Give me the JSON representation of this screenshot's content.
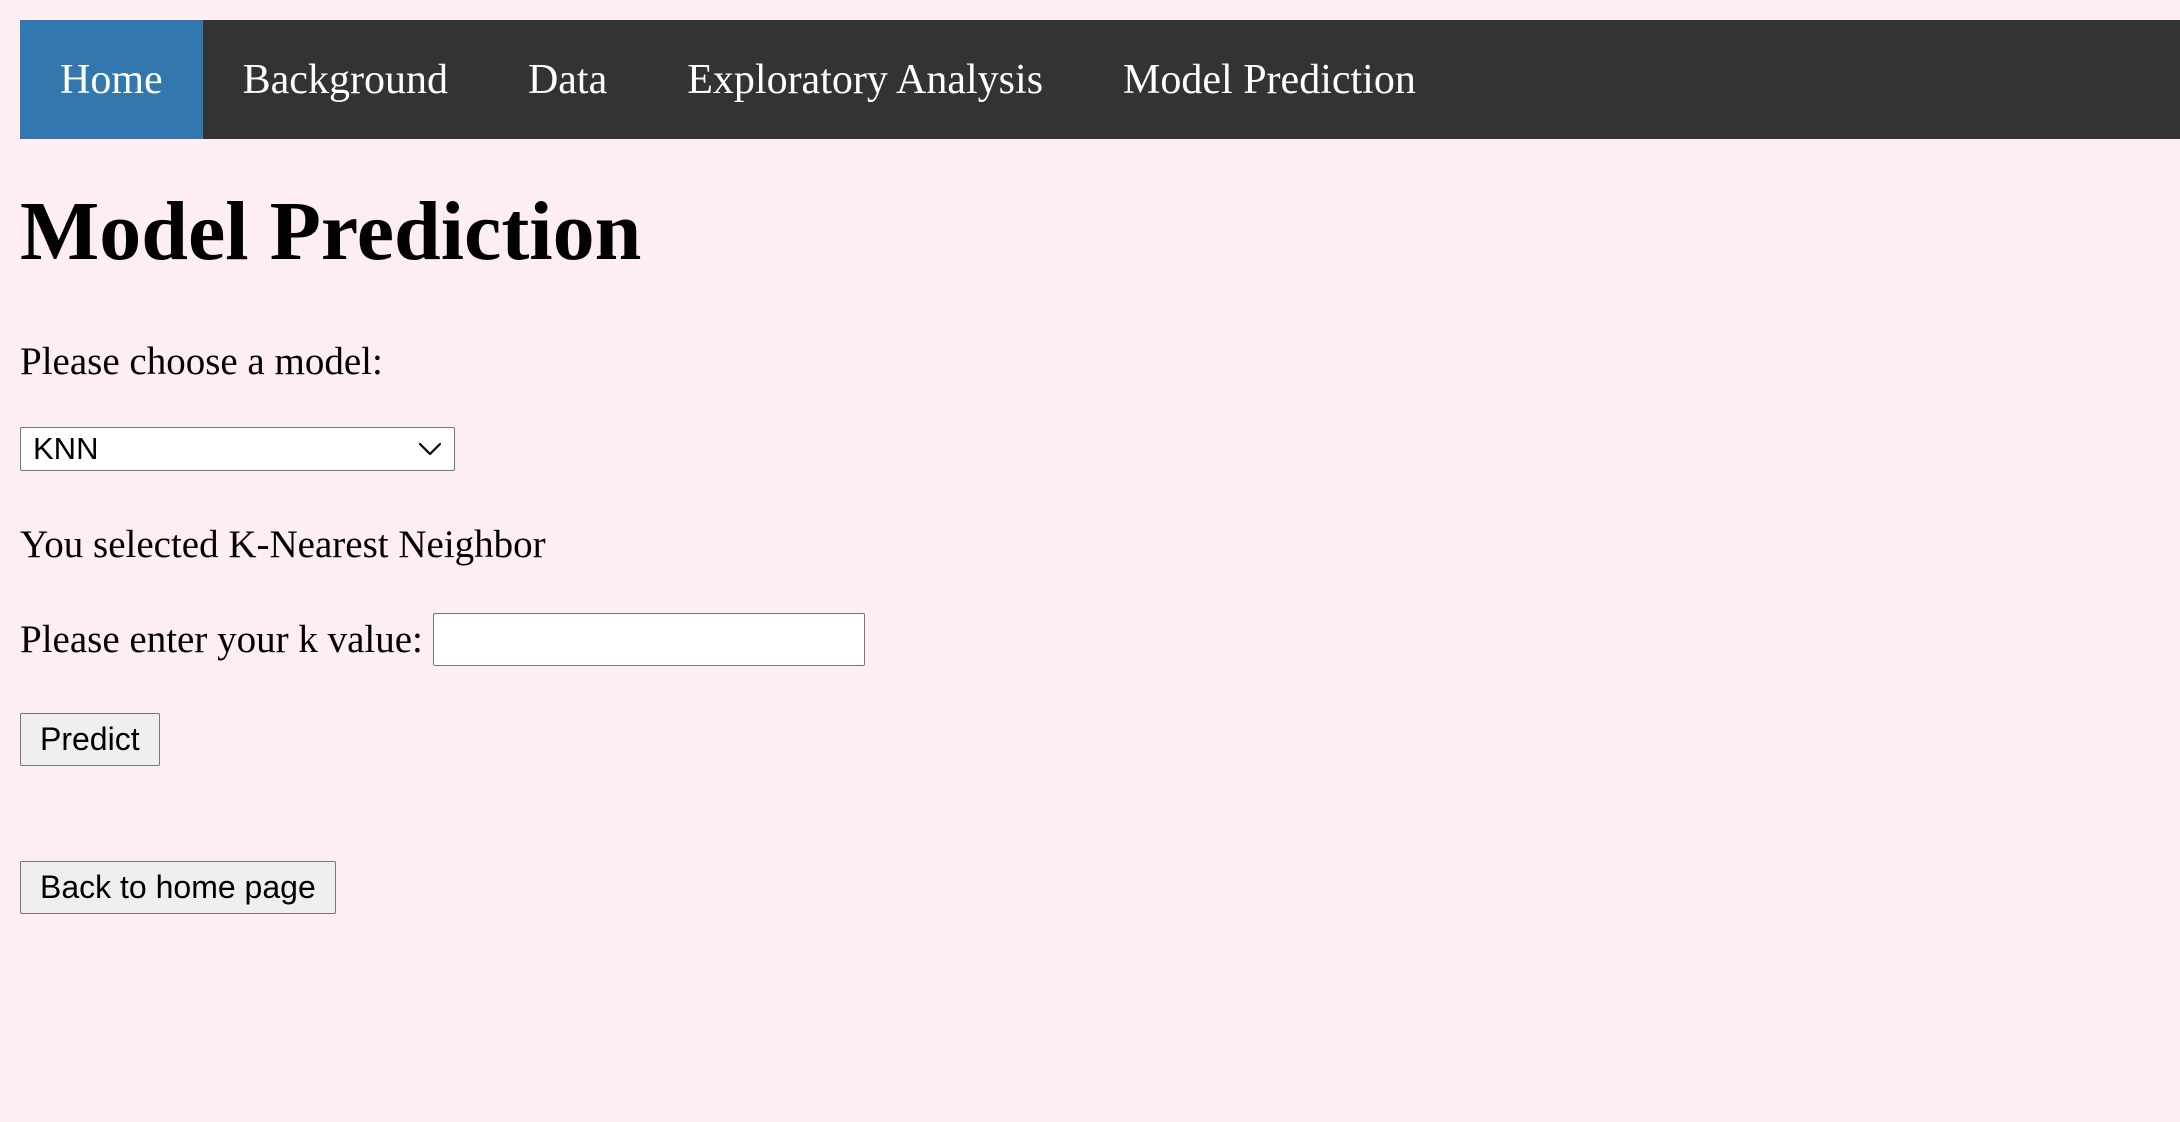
{
  "nav": {
    "items": [
      {
        "label": "Home",
        "active": true
      },
      {
        "label": "Background",
        "active": false
      },
      {
        "label": "Data",
        "active": false
      },
      {
        "label": "Exploratory Analysis",
        "active": false
      },
      {
        "label": "Model Prediction",
        "active": false
      }
    ]
  },
  "main": {
    "title": "Model Prediction",
    "choose_label": "Please choose a model:",
    "model_select": {
      "selected": "KNN"
    },
    "selection_text": "You selected K-Nearest Neighbor",
    "k_label": "Please enter your k value:",
    "k_value": "",
    "predict_button": "Predict",
    "back_button": "Back to home page"
  },
  "colors": {
    "page_background": "#fdeef3",
    "nav_background": "#333333",
    "nav_active": "#3277ad",
    "nav_text": "#ffffff"
  },
  "icons": {
    "select_arrow": "chevron-down-icon"
  }
}
